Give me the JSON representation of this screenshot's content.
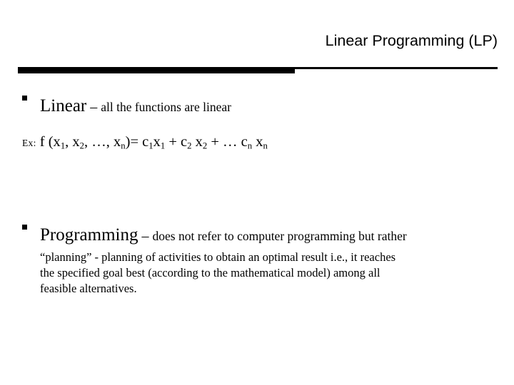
{
  "slide": {
    "title": "Linear Programming (LP)",
    "divider": {
      "accent_color": "#000000"
    },
    "bullets": [
      {
        "marker": "square-bullet",
        "lead": "Linear",
        "dash": " – ",
        "tail": "all the functions are linear"
      },
      {
        "marker": "square-bullet",
        "lead": "Programming",
        "dash": " – ",
        "tail": "does not refer to computer programming but rather"
      }
    ],
    "example": {
      "label": "Ex:",
      "function_open": "f (x",
      "sub_1": "1",
      "comma_1": ", x",
      "sub_2": "2",
      "ellipsis": ", …, x",
      "sub_n": "n",
      "equals": ")= c",
      "sub_c1": "1",
      "x1": "x",
      "sub_x1": "1",
      "plus_1": " + c",
      "sub_c2": "2",
      "x2": " x",
      "sub_x2": "2",
      "plus_2": " + … c",
      "sub_cn": "n",
      "xn": " x",
      "sub_xn": "n"
    },
    "paragraph": [
      "“planning” - planning of activities to obtain an optimal result i.e., it reaches",
      "the specified goal best (according to the mathematical model) among all",
      "feasible alternatives."
    ]
  }
}
